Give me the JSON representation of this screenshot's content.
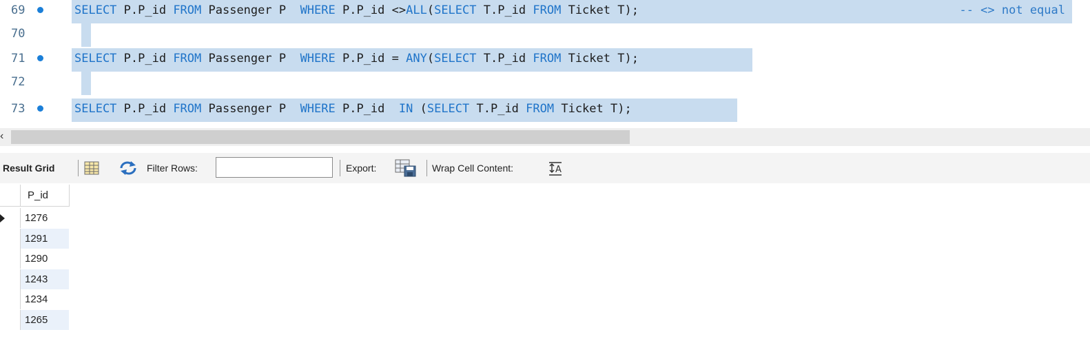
{
  "editor": {
    "lines": [
      {
        "num": "69",
        "breakpoint": true,
        "parts": [
          [
            "kw",
            "SELECT"
          ],
          [
            "tx",
            " P.P_id "
          ],
          [
            "kw",
            "FROM"
          ],
          [
            "tx",
            " Passenger P  "
          ],
          [
            "kw",
            "WHERE"
          ],
          [
            "tx",
            " P.P_id <>"
          ],
          [
            "kw",
            "ALL"
          ],
          [
            "tx",
            "("
          ],
          [
            "kw",
            "SELECT"
          ],
          [
            "tx",
            " T.P_id "
          ],
          [
            "kw",
            "FROM"
          ],
          [
            "tx",
            " Ticket T);"
          ]
        ],
        "comment": "-- <> not equal"
      },
      {
        "num": "70",
        "breakpoint": false,
        "parts": [],
        "comment": ""
      },
      {
        "num": "71",
        "breakpoint": true,
        "parts": [
          [
            "kw",
            "SELECT"
          ],
          [
            "tx",
            " P.P_id "
          ],
          [
            "kw",
            "FROM"
          ],
          [
            "tx",
            " Passenger P  "
          ],
          [
            "kw",
            "WHERE"
          ],
          [
            "tx",
            " P.P_id = "
          ],
          [
            "kw",
            "ANY"
          ],
          [
            "tx",
            "("
          ],
          [
            "kw",
            "SELECT"
          ],
          [
            "tx",
            " T.P_id "
          ],
          [
            "kw",
            "FROM"
          ],
          [
            "tx",
            " Ticket T);"
          ]
        ],
        "comment": ""
      },
      {
        "num": "72",
        "breakpoint": false,
        "parts": [],
        "comment": ""
      },
      {
        "num": "73",
        "breakpoint": true,
        "parts": [
          [
            "kw",
            "SELECT"
          ],
          [
            "tx",
            " P.P_id "
          ],
          [
            "kw",
            "FROM"
          ],
          [
            "tx",
            " Passenger P  "
          ],
          [
            "kw",
            "WHERE"
          ],
          [
            "tx",
            " P.P_id  "
          ],
          [
            "kw",
            "IN"
          ],
          [
            "tx",
            " ("
          ],
          [
            "kw",
            "SELECT"
          ],
          [
            "tx",
            " T.P_id "
          ],
          [
            "kw",
            "FROM"
          ],
          [
            "tx",
            " Ticket T);"
          ]
        ],
        "comment": ""
      }
    ]
  },
  "toolbar": {
    "result_grid_label": "Result Grid",
    "filter_label": "Filter Rows:",
    "filter_value": "",
    "export_label": "Export:",
    "wrap_label": "Wrap Cell Content:"
  },
  "grid": {
    "column": "P_id",
    "rows": [
      "1276",
      "1291",
      "1290",
      "1243",
      "1234",
      "1265"
    ],
    "current_row": 0
  },
  "colors": {
    "keyword": "#1f74c9",
    "selection": "#c8dcef",
    "alt_row": "#eaf1fa"
  }
}
